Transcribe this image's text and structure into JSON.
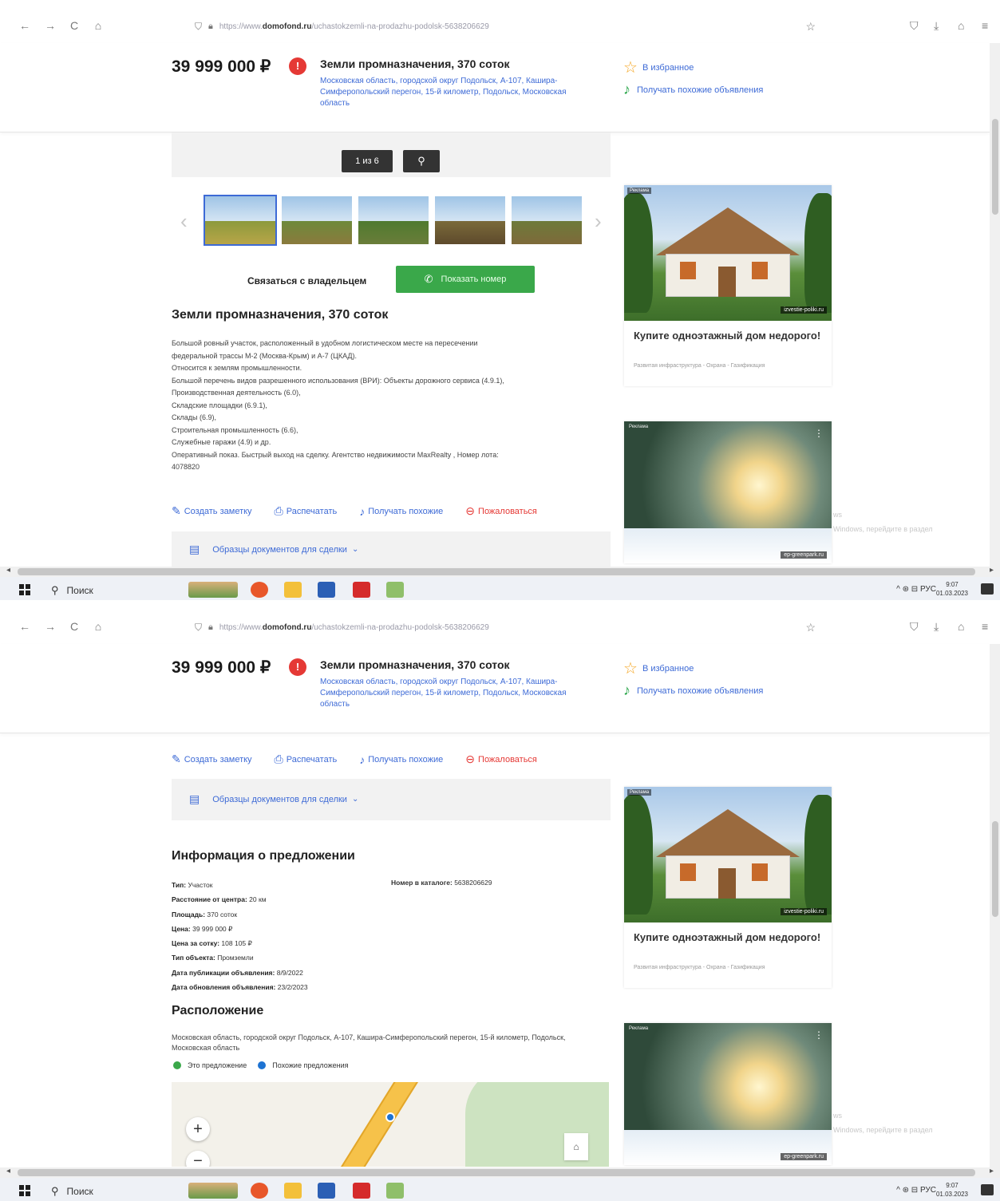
{
  "browser": {
    "back": "←",
    "forward": "→",
    "reload": "C",
    "home": "⌂",
    "url_prefix": "https://www.",
    "url_domain": "domofond.ru",
    "url_path": "/uchastokzemli-na-prodazhu-podolsk-5638206629"
  },
  "header": {
    "price": "39 999 000 ₽",
    "title": "Земли промназначения, 370 соток",
    "address": "Московская область, городской округ Подольск, А-107, Кашира-Симферопольский перегон, 15-й километр, Подольск, Московская область",
    "favorites": "В избранное",
    "similar": "Получать похожие объявления"
  },
  "gallery": {
    "counter": "1 из 6",
    "zoom_icon": "magnifier-icon"
  },
  "contact": {
    "label": "Связаться с владельцем",
    "show_number": "Показать номер"
  },
  "listing": {
    "title": "Земли промназначения, 370 соток",
    "description": [
      "Большой ровный участок, расположенный в удобном логистическом месте на пересечении",
      "федеральной трассы М-2 (Москва-Крым) и А-7 (ЦКАД).",
      "Относится к землям промышленности.",
      "Большой перечень видов разрешенного использования (ВРИ): Объекты дорожного сервиса (4.9.1),",
      "Производственная деятельность (6.0),",
      "Складские площадки (6.9.1),",
      "Склады (6.9),",
      "Строительная промышленность (6.6),",
      "Служебные гаражи (4.9) и др.",
      "Оперативный показ. Быстрый выход на сделку. Агентство недвижимости MaxRealty , Номер лота:",
      "4078820"
    ]
  },
  "actions": {
    "note": "Создать заметку",
    "print": "Распечатать",
    "similar": "Получать похожие",
    "complain": "Пожаловаться"
  },
  "docs": {
    "label": "Образцы документов для сделки"
  },
  "ads": {
    "ad1_title": "Купите одноэтажный дом недорого!",
    "ad1_sub": "Развитая инфраструктура - Охрана - Газификация",
    "ad1_tag": "izvestie-poliki.ru",
    "ad2_tag": "ep-greenpark.ru",
    "ad_label": "Реклама"
  },
  "watermark": {
    "line1": "ws",
    "line2": "Windows, перейдите в раздел"
  },
  "taskbar": {
    "search": "Поиск",
    "lang": "РУС",
    "time": "9:07",
    "date": "01.03.2023"
  },
  "info": {
    "title": "Информация о предложении",
    "rows": [
      {
        "label": "Тип:",
        "value": "Участок"
      },
      {
        "label": "Расстояние от центра:",
        "value": "20 км"
      },
      {
        "label": "Площадь:",
        "value": "370 соток"
      },
      {
        "label": "Цена:",
        "value": "39 999 000 ₽"
      },
      {
        "label": "Цена за сотку:",
        "value": "108 105 ₽"
      },
      {
        "label": "Тип объекта:",
        "value": "Промземли"
      },
      {
        "label": "Дата публикации объявления:",
        "value": "8/9/2022"
      },
      {
        "label": "Дата обновления объявления:",
        "value": "23/2/2023"
      }
    ],
    "catalog_label": "Номер в каталоге:",
    "catalog_value": "5638206629"
  },
  "location": {
    "title": "Расположение",
    "address": "Московская область, городской округ Подольск, А-107, Кашира-Симферопольский перегон, 15-й километр, Подольск, Московская область",
    "legend_this": "Это предложение",
    "legend_similar": "Похожие предложения",
    "legend_this_color": "#3aa84a",
    "legend_similar_color": "#1e73d2",
    "zoom_in": "+",
    "zoom_out": "−"
  },
  "colors": {
    "link": "#3d6ad6",
    "green": "#3aa84a",
    "red": "#e53935"
  }
}
